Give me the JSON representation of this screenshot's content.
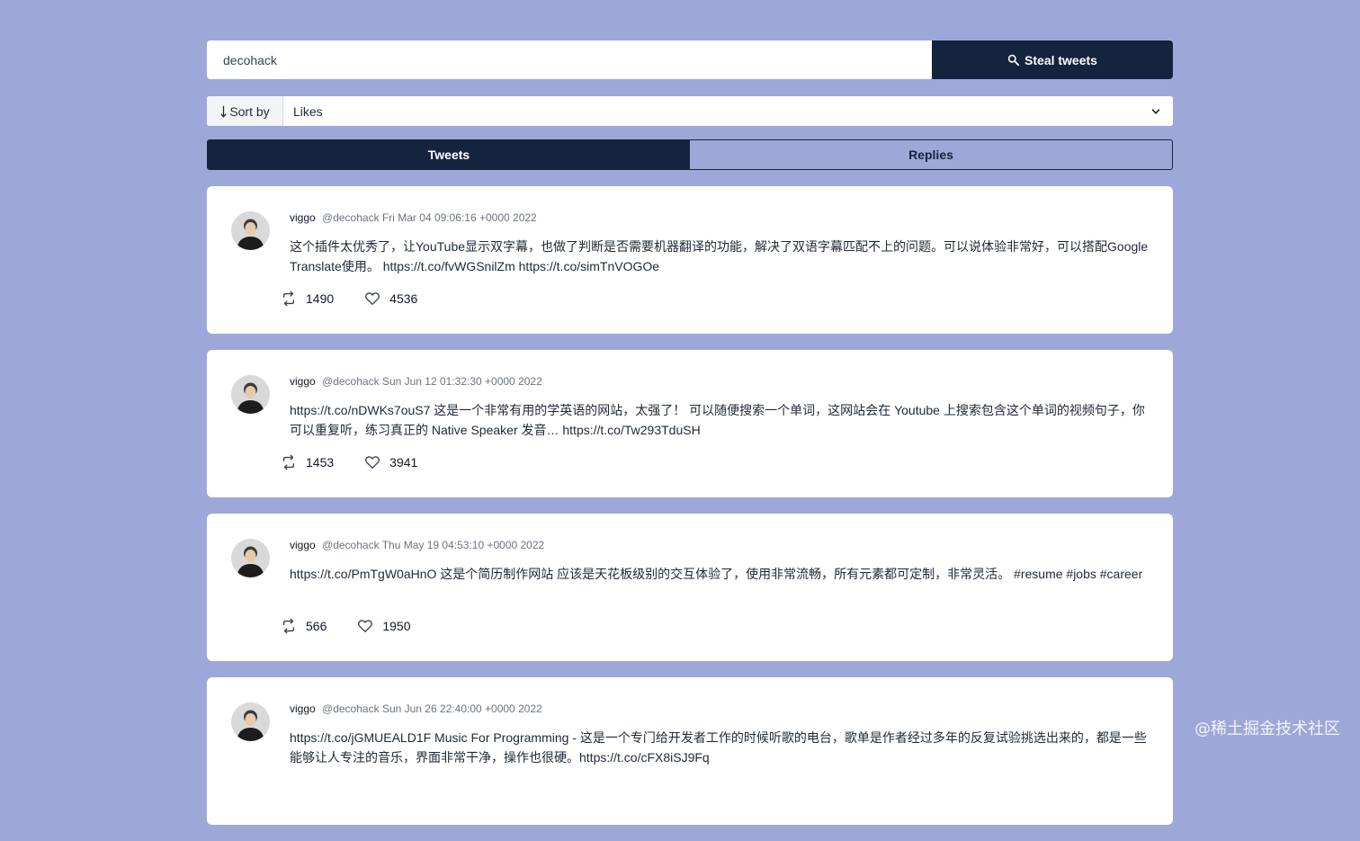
{
  "search": {
    "value": "decohack",
    "button_label": "Steal tweets"
  },
  "sort": {
    "label": "Sort by",
    "selected": "Likes"
  },
  "tabs": [
    {
      "label": "Tweets",
      "active": true
    },
    {
      "label": "Replies",
      "active": false
    }
  ],
  "tweets": [
    {
      "name": "viggo",
      "handle": "@decohack",
      "date": "Fri Mar 04 09:06:16 +0000 2022",
      "text": "这个插件太优秀了，让YouTube显示双字幕，也做了判断是否需要机器翻译的功能，解决了双语字幕匹配不上的问题。可以说体验非常好，可以搭配Google Translate使用。 https://t.co/fvWGSnilZm https://t.co/simTnVOGOe",
      "retweets": "1490",
      "likes": "4536"
    },
    {
      "name": "viggo",
      "handle": "@decohack",
      "date": "Sun Jun 12 01:32:30 +0000 2022",
      "text": "https://t.co/nDWKs7ouS7 这是一个非常有用的学英语的网站，太强了！ 可以随便搜索一个单词，这网站会在 Youtube 上搜索包含这个单词的视频句子，你可以重复听，练习真正的 Native Speaker 发音… https://t.co/Tw293TduSH",
      "retweets": "1453",
      "likes": "3941"
    },
    {
      "name": "viggo",
      "handle": "@decohack",
      "date": "Thu May 19 04:53:10 +0000 2022",
      "text": "https://t.co/PmTgW0aHnO 这是个简历制作网站 应该是天花板级别的交互体验了，使用非常流畅，所有元素都可定制，非常灵活。 #resume #jobs #career",
      "retweets": "566",
      "likes": "1950"
    },
    {
      "name": "viggo",
      "handle": "@decohack",
      "date": "Sun Jun 26 22:40:00 +0000 2022",
      "text": "https://t.co/jGMUEALD1F Music For Programming - 这是一个专门给开发者工作的时候听歌的电台，歌单是作者经过多年的反复试验挑选出来的，都是一些能够让人专注的音乐，界面非常干净，操作也很硬。https://t.co/cFX8iSJ9Fq",
      "retweets": "",
      "likes": ""
    }
  ],
  "watermark": "@稀土掘金技术社区"
}
